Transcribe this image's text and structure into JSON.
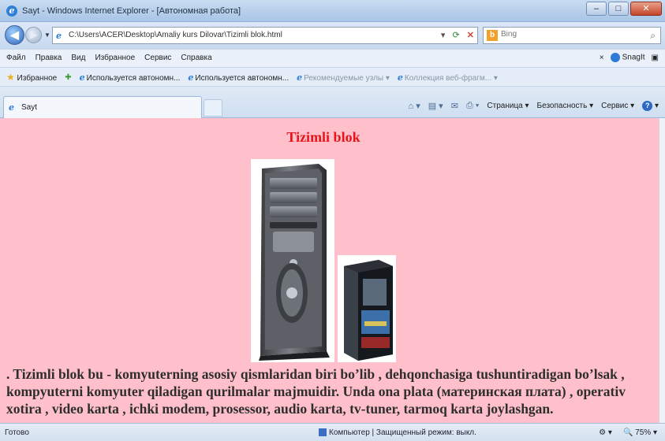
{
  "window": {
    "title": "Sayt - Windows Internet Explorer - [Автономная работа]",
    "minimize": "–",
    "maximize": "□",
    "close": "✕"
  },
  "address": {
    "url": "C:\\Users\\ACER\\Desktop\\Amaliy kurs Dilovar\\Tizimli blok.html",
    "search_placeholder": "Bing"
  },
  "menu": {
    "items": [
      "Файл",
      "Правка",
      "Вид",
      "Избранное",
      "Сервис",
      "Справка"
    ],
    "snagit": "SnagIt"
  },
  "favorites": {
    "label": "Избранное",
    "items": [
      "Используется автономн...",
      "Используется автономн...",
      "Рекомендуемые узлы ▾",
      "Коллекция веб-фрагм... ▾"
    ]
  },
  "tab": {
    "label": "Sayt"
  },
  "commands": {
    "page": "Страница ▾",
    "security": "Безопасность ▾",
    "tools": "Сервис ▾"
  },
  "content": {
    "heading": "Tizimli blok",
    "paragraph": ". Tizimli blok bu - komyuterning asosiy qismlaridan biri bo’lib , dehqonchasiga tushuntiradigan bo’lsak , kompyuterni komyuter qiladigan qurilmalar majmuidir. Unda ona plata (материнская плата) , operativ xotira , video karta , ichki modem, prosessor, audio karta, tv-tuner, tarmoq karta joylashgan."
  },
  "status": {
    "left": "Готово",
    "zone": "Компьютер | Защищенный режим: выкл.",
    "zoom": "75%"
  },
  "colors": {
    "page_background": "#ffc0cb",
    "heading": "#e8141c"
  }
}
